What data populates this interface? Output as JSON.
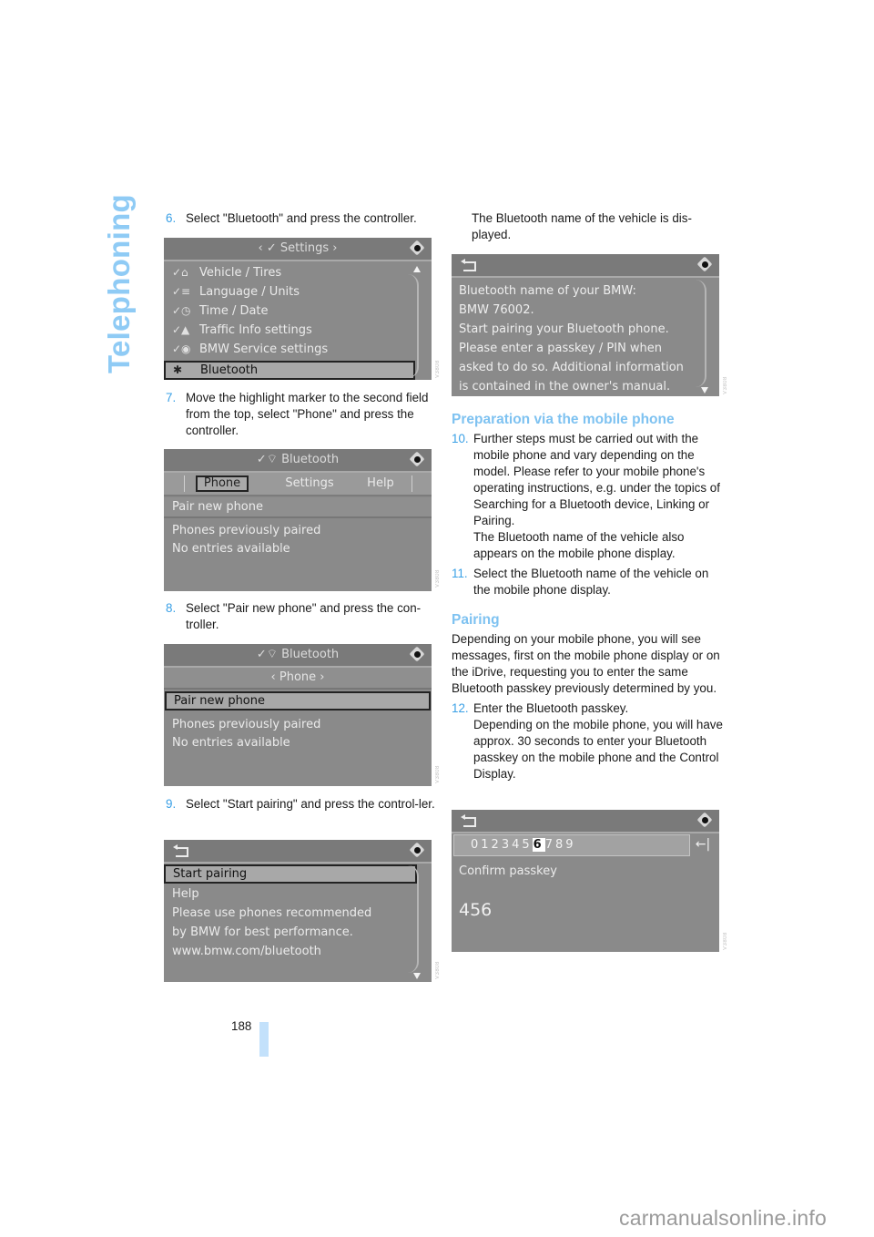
{
  "chapter_title": "Telephoning",
  "page_number": "188",
  "watermark": "carmanualsonline.info",
  "accent_color": "#3aa0e6",
  "heading_color": "#7ec2f1",
  "left_column": {
    "step6": {
      "num": "6.",
      "text": "Select \"Bluetooth\" and press the controller."
    },
    "step7": {
      "num": "7.",
      "text": "Move the highlight marker to the second field from the top, select \"Phone\" and press the controller."
    },
    "step8": {
      "num": "8.",
      "text": "Select \"Pair new phone\" and press the con-troller."
    },
    "step9": {
      "num": "9.",
      "text": "Select \"Start pairing\" and press the control-ler."
    }
  },
  "screens": {
    "settings": {
      "title": "‹ ✓ Settings ›",
      "items": [
        {
          "icon": "vehicle-icon",
          "glyph": "✓⌂",
          "label": "Vehicle / Tires"
        },
        {
          "icon": "language-icon",
          "glyph": "✓≡",
          "label": "Language / Units"
        },
        {
          "icon": "clock-icon",
          "glyph": "✓◷",
          "label": "Time / Date"
        },
        {
          "icon": "traffic-warning-icon",
          "glyph": "✓▲",
          "label": "Traffic Info settings"
        },
        {
          "icon": "service-icon",
          "glyph": "✓◉",
          "label": "BMW Service settings"
        },
        {
          "icon": "bluetooth-icon",
          "glyph": "✱",
          "label": "Bluetooth",
          "selected": true
        }
      ]
    },
    "bluetooth_tabs": {
      "title": "Bluetooth",
      "tabs": [
        {
          "label": "Phone",
          "active": true
        },
        {
          "label": "Settings",
          "active": false
        },
        {
          "label": "Help",
          "active": false
        }
      ],
      "items": [
        "Pair new phone",
        "Phones previously paired",
        "No entries available"
      ]
    },
    "bluetooth_phone": {
      "title": "Bluetooth",
      "subtitle": "‹ Phone ›",
      "items": [
        {
          "label": "Pair new phone",
          "selected": true
        },
        {
          "label": "Phones previously paired"
        },
        {
          "label": "No entries available"
        }
      ]
    },
    "start_pairing": {
      "items": [
        {
          "label": "Start pairing",
          "selected": true
        },
        {
          "label": "Help"
        },
        {
          "label": "Please use phones recommended"
        },
        {
          "label": "by BMW for best performance."
        },
        {
          "label": "www.bmw.com/bluetooth"
        }
      ]
    },
    "bt_name": {
      "lines": [
        "Bluetooth name of your BMW:",
        "BMW 76002.",
        "Start pairing your Bluetooth phone.",
        "Please enter a passkey / PIN when",
        "asked to do so. Additional information",
        "is contained in the owner's manual."
      ]
    },
    "passkey": {
      "digits_before": "012345",
      "digit_selected": "6",
      "digits_after": "789",
      "enter_glyph": "←|",
      "label": "Confirm passkey",
      "value": "456"
    }
  },
  "right_column": {
    "intro": "The Bluetooth name of the vehicle is dis-played.",
    "heading_prep": "Preparation via the mobile phone",
    "step10": {
      "num": "10.",
      "text": "Further steps must be carried out with the mobile phone and vary depending on the model. Please refer to your mobile phone's operating instructions, e.g. under the topics of Searching for a Bluetooth device, Linking or Pairing.",
      "text2": "The Bluetooth name of the vehicle also appears on the mobile phone display."
    },
    "step11": {
      "num": "11.",
      "text": "Select the Bluetooth name of the vehicle on the mobile phone display."
    },
    "heading_pairing": "Pairing",
    "pairing_para": "Depending on your mobile phone, you will see messages, first on the mobile phone display or on the iDrive, requesting you to enter the same Bluetooth passkey previously determined by you.",
    "step12": {
      "num": "12.",
      "text": "Enter the Bluetooth passkey.",
      "text2": "Depending on the mobile phone, you will have approx. 30 seconds to enter your Bluetooth passkey on the mobile phone and the Control Display."
    }
  }
}
